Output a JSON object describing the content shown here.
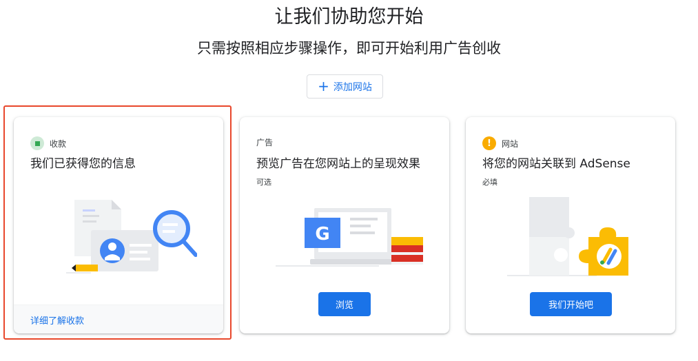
{
  "header": {
    "title": "让我们协助您开始",
    "subtitle": "只需按照相应步骤操作，即可开始利用广告创收",
    "add_site_label": "添加网站"
  },
  "cards": [
    {
      "tag": "收款",
      "title": "我们已获得您的信息",
      "footer_link": "详细了解收款",
      "status": "complete"
    },
    {
      "tag": "广告",
      "title": "预览广告在您网站上的呈现效果",
      "subtitle": "可选",
      "button": "浏览",
      "illustration_letter": "G"
    },
    {
      "tag": "网站",
      "title": "将您的网站关联到 AdSense",
      "subtitle": "必填",
      "button": "我们开始吧",
      "status_icon": "!"
    }
  ],
  "colors": {
    "accent": "#1a73e8",
    "highlight": "#e8472b",
    "success": "#34a853",
    "warning": "#f9ab00"
  }
}
